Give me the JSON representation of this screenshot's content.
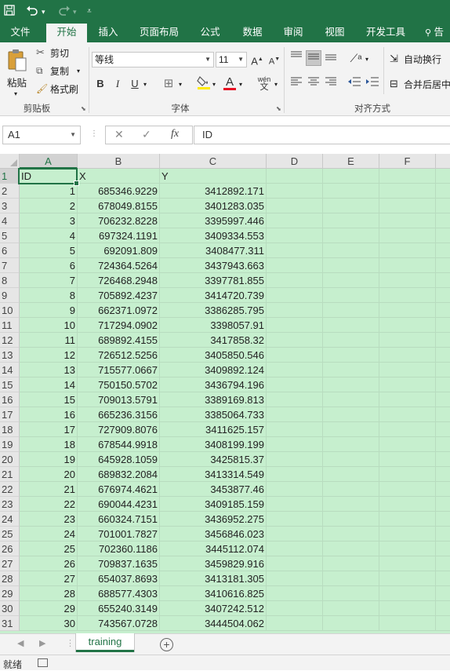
{
  "title_bar": {
    "save_icon": "save-icon",
    "undo_icon": "undo-icon",
    "redo_icon": "redo-icon",
    "customize_icon": "customize-qat-icon"
  },
  "ribbon_tabs": [
    "文件",
    "开始",
    "插入",
    "页面布局",
    "公式",
    "数据",
    "审阅",
    "视图",
    "开发工具",
    "告"
  ],
  "active_tab": "开始",
  "clipboard": {
    "paste": "粘贴",
    "cut": "剪切",
    "copy": "复制",
    "format_painter": "格式刷",
    "group_label": "剪贴板"
  },
  "font": {
    "name": "等线",
    "size": "11",
    "group_label": "字体",
    "bold": "B",
    "italic": "I",
    "underline": "U",
    "grow": "A",
    "shrink": "A",
    "font_color_glyph": "A",
    "phonetic": "wén"
  },
  "alignment": {
    "wrap_text": "自动换行",
    "merge_center": "合并后居中",
    "group_label": "对齐方式"
  },
  "formula_bar": {
    "name_box": "A1",
    "fx": "fx",
    "content": "ID"
  },
  "columns": [
    "A",
    "B",
    "C",
    "D",
    "E",
    "F"
  ],
  "header_row": {
    "row": "1",
    "a": "ID",
    "b": "X",
    "c": "Y"
  },
  "rows": [
    {
      "row": "2",
      "id": "1",
      "x": "685346.9229",
      "y": "3412892.171"
    },
    {
      "row": "3",
      "id": "2",
      "x": "678049.8155",
      "y": "3401283.035"
    },
    {
      "row": "4",
      "id": "3",
      "x": "706232.8228",
      "y": "3395997.446"
    },
    {
      "row": "5",
      "id": "4",
      "x": "697324.1191",
      "y": "3409334.553"
    },
    {
      "row": "6",
      "id": "5",
      "x": "692091.809",
      "y": "3408477.311"
    },
    {
      "row": "7",
      "id": "6",
      "x": "724364.5264",
      "y": "3437943.663"
    },
    {
      "row": "8",
      "id": "7",
      "x": "726468.2948",
      "y": "3397781.855"
    },
    {
      "row": "9",
      "id": "8",
      "x": "705892.4237",
      "y": "3414720.739"
    },
    {
      "row": "10",
      "id": "9",
      "x": "662371.0972",
      "y": "3386285.795"
    },
    {
      "row": "11",
      "id": "10",
      "x": "717294.0902",
      "y": "3398057.91"
    },
    {
      "row": "12",
      "id": "11",
      "x": "689892.4155",
      "y": "3417858.32"
    },
    {
      "row": "13",
      "id": "12",
      "x": "726512.5256",
      "y": "3405850.546"
    },
    {
      "row": "14",
      "id": "13",
      "x": "715577.0667",
      "y": "3409892.124"
    },
    {
      "row": "15",
      "id": "14",
      "x": "750150.5702",
      "y": "3436794.196"
    },
    {
      "row": "16",
      "id": "15",
      "x": "709013.5791",
      "y": "3389169.813"
    },
    {
      "row": "17",
      "id": "16",
      "x": "665236.3156",
      "y": "3385064.733"
    },
    {
      "row": "18",
      "id": "17",
      "x": "727909.8076",
      "y": "3411625.157"
    },
    {
      "row": "19",
      "id": "18",
      "x": "678544.9918",
      "y": "3408199.199"
    },
    {
      "row": "20",
      "id": "19",
      "x": "645928.1059",
      "y": "3425815.37"
    },
    {
      "row": "21",
      "id": "20",
      "x": "689832.2084",
      "y": "3413314.549"
    },
    {
      "row": "22",
      "id": "21",
      "x": "676974.4621",
      "y": "3453877.46"
    },
    {
      "row": "23",
      "id": "22",
      "x": "690044.4231",
      "y": "3409185.159"
    },
    {
      "row": "24",
      "id": "23",
      "x": "660324.7151",
      "y": "3436952.275"
    },
    {
      "row": "25",
      "id": "24",
      "x": "701001.7827",
      "y": "3456846.023"
    },
    {
      "row": "26",
      "id": "25",
      "x": "702360.1186",
      "y": "3445112.074"
    },
    {
      "row": "27",
      "id": "26",
      "x": "709837.1635",
      "y": "3459829.916"
    },
    {
      "row": "28",
      "id": "27",
      "x": "654037.8693",
      "y": "3413181.305"
    },
    {
      "row": "29",
      "id": "28",
      "x": "688577.4303",
      "y": "3410616.825"
    },
    {
      "row": "30",
      "id": "29",
      "x": "655240.3149",
      "y": "3407242.512"
    },
    {
      "row": "31",
      "id": "30",
      "x": "743567.0728",
      "y": "3444504.062"
    }
  ],
  "sheet_tabs": [
    "training"
  ],
  "status": {
    "mode": "就绪"
  },
  "colors": {
    "accent": "#217346",
    "cell_fill": "#c6efce"
  }
}
